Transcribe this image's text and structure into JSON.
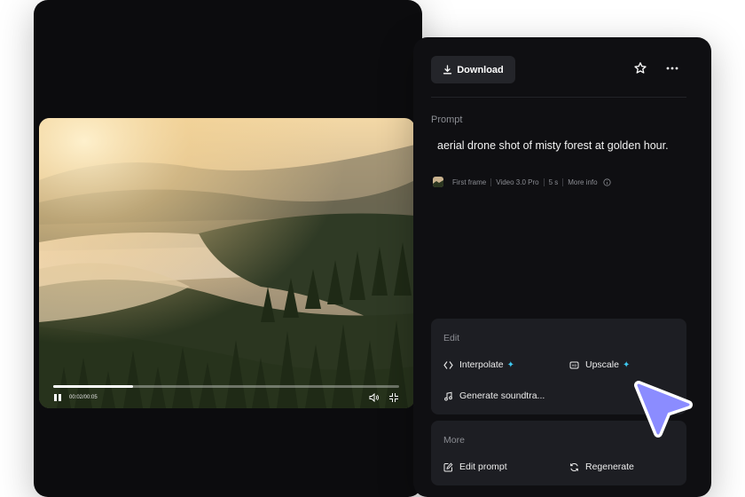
{
  "player": {
    "time": "00:02/00:05",
    "progress": 0.23
  },
  "toolbar": {
    "download_label": "Download"
  },
  "prompt": {
    "label": "Prompt",
    "text": "aerial drone shot of misty forest at golden hour."
  },
  "meta": {
    "first_frame": "First frame",
    "model": "Video 3.0 Pro",
    "duration": "5 s",
    "more_info": "More info"
  },
  "edit_card": {
    "title": "Edit",
    "interpolate": "Interpolate",
    "upscale": "Upscale",
    "soundtrack": "Generate soundtra..."
  },
  "more_card": {
    "title": "More",
    "edit_prompt": "Edit prompt",
    "regenerate": "Regenerate"
  },
  "colors": {
    "panel": "#0c0c0e",
    "card": "#1d1e23",
    "accent_sparkle": "#3ec8f0",
    "cursor": "#8b8cff"
  },
  "icons": [
    "download-icon",
    "star-icon",
    "more-icon",
    "info-icon",
    "interpolate-icon",
    "upscale-icon",
    "music-icon",
    "edit-icon",
    "regenerate-icon",
    "pause-icon",
    "volume-icon",
    "fullscreen-exit-icon",
    "cursor-icon"
  ]
}
